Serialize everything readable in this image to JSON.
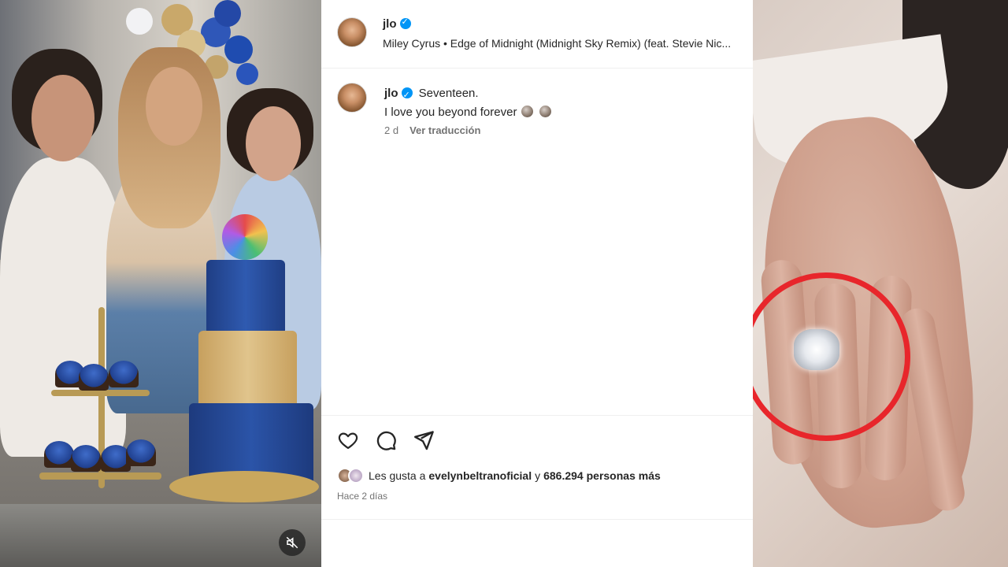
{
  "post": {
    "author": "jlo",
    "music": "Miley Cyrus • Edge of Midnight (Midnight Sky Remix) (feat. Stevie Nic...",
    "caption_line1": "Seventeen.",
    "caption_line2": "I love you beyond forever",
    "caption_age": "2 d",
    "translate_label": "Ver traducción",
    "likes_prefix": "Les gusta a",
    "likes_user": "evelynbeltranoficial",
    "likes_joiner": "y",
    "likes_count": "686.294 personas más",
    "posted_ago": "Hace 2 días"
  },
  "icons": {
    "like": "heart-icon",
    "comment": "comment-icon",
    "share": "share-icon",
    "mute": "mute-icon",
    "verified": "verified-badge-icon"
  },
  "colors": {
    "verified": "#0095f6",
    "highlight_circle": "#e8262b",
    "secondary_text": "#737373"
  }
}
